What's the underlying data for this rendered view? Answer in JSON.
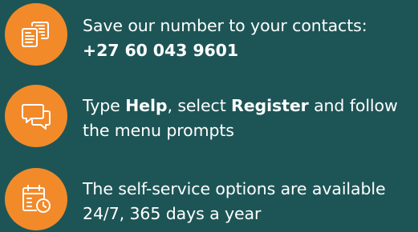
{
  "colors": {
    "background": "#1d5556",
    "icon_circle": "#f28a2a",
    "text": "#ffffff"
  },
  "steps": [
    {
      "icon": "contact-cards-icon",
      "line1": "Save our number to your contacts:",
      "line2": "+27 60 043 9601"
    },
    {
      "icon": "chat-bubbles-icon",
      "line1_prefix": "Type ",
      "keyword_help": "Help",
      "line1_middle": ", select ",
      "keyword_register": "Register",
      "line1_suffix": " and follow",
      "line2": "the menu prompts"
    },
    {
      "icon": "calendar-clock-icon",
      "line1": "The self-service options are available",
      "line2": "24/7, 365 days a year"
    }
  ]
}
